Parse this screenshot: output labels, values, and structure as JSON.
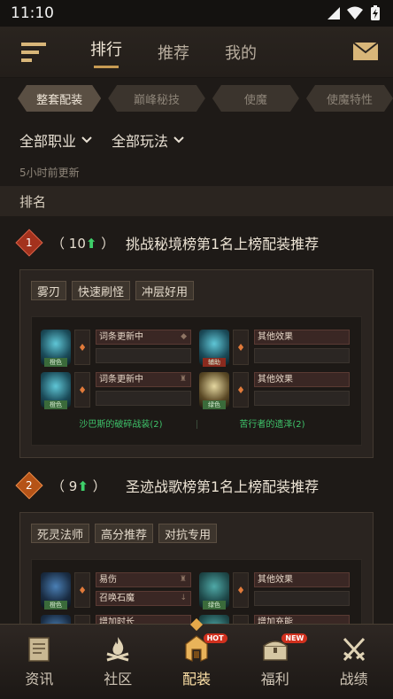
{
  "status": {
    "time": "11:10"
  },
  "nav": {
    "tabs": [
      "排行",
      "推荐",
      "我的"
    ],
    "active": 0
  },
  "subtabs": [
    "整套配装",
    "巅峰秘技",
    "使魔",
    "使魔特性"
  ],
  "filters": {
    "class": "全部职业",
    "mode": "全部玩法"
  },
  "update_note": "5小时前更新",
  "section_header": "排名",
  "entries": [
    {
      "rank": "1",
      "change_open": "（",
      "change_value": "10",
      "change_close": "）",
      "title": "挑战秘境榜第1名上榜配装推荐",
      "tags": [
        "雾刃",
        "快速刷怪",
        "冲层好用"
      ],
      "rows": [
        {
          "left": {
            "gem_label": "橙色",
            "slots": [
              "词条更新中",
              ""
            ]
          },
          "right": {
            "gem_label": "辅助",
            "slots": [
              "其他效果",
              ""
            ]
          }
        },
        {
          "left": {
            "gem_label": "橙色",
            "slots": [
              "词条更新中",
              ""
            ]
          },
          "right": {
            "gem_label": "绿色",
            "slots": [
              "其他效果",
              ""
            ]
          }
        }
      ],
      "sets": [
        "沙巴斯的破碎战装(2)",
        "苦行者的遗泽(2)"
      ]
    },
    {
      "rank": "2",
      "change_open": "（",
      "change_value": "9",
      "change_close": "）",
      "title": "圣迹战歌榜第1名上榜配装推荐",
      "tags": [
        "死灵法师",
        "高分推荐",
        "对抗专用"
      ],
      "rows": [
        {
          "left": {
            "gem_label": "橙色",
            "slots": [
              "易伤",
              "召唤石魔"
            ]
          },
          "right": {
            "gem_label": "绿色",
            "slots": [
              "其他效果",
              ""
            ]
          }
        },
        {
          "left": {
            "gem_label": "",
            "slots": [
              "增加时长",
              ""
            ]
          },
          "right": {
            "gem_label": "",
            "slots": [
              "增加充能",
              ""
            ]
          }
        }
      ]
    }
  ],
  "bottom_nav": [
    {
      "label": "资讯",
      "icon": "scroll-icon"
    },
    {
      "label": "社区",
      "icon": "campfire-icon"
    },
    {
      "label": "配装",
      "icon": "helmet-icon",
      "badge": "HOT"
    },
    {
      "label": "福利",
      "icon": "chest-icon",
      "badge": "NEW"
    },
    {
      "label": "战绩",
      "icon": "crossed-swords-icon"
    }
  ],
  "colors": {
    "accent": "#c79b53",
    "up_arrow": "#3ecf6a",
    "set_bonus": "#3ec36a",
    "rank1": "#a3321d",
    "rank2": "#b55317"
  }
}
